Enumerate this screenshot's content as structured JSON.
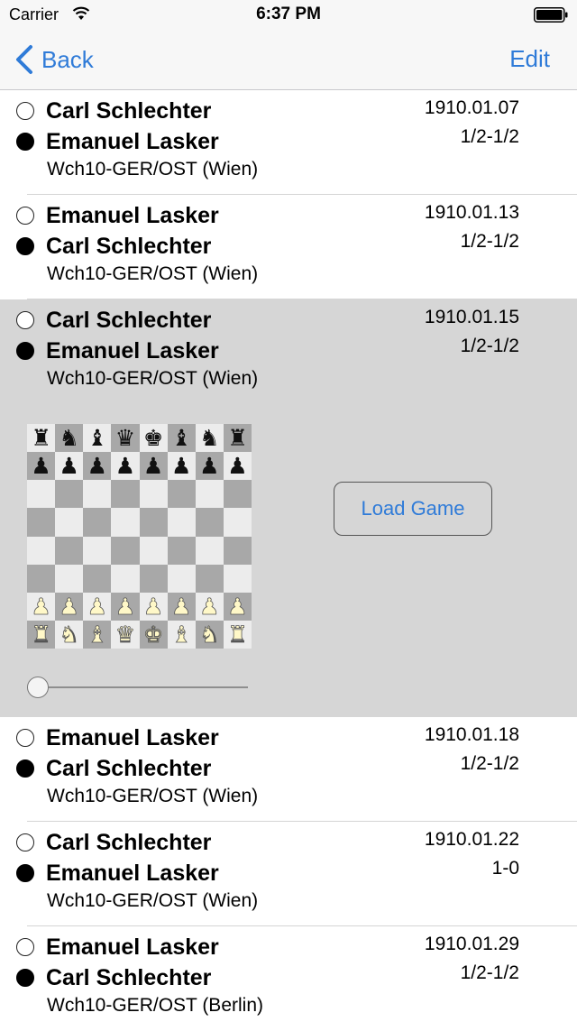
{
  "status_bar": {
    "carrier": "Carrier",
    "time": "6:37 PM",
    "wifi_icon": "wifi-icon",
    "battery_icon": "battery-icon"
  },
  "nav": {
    "back_label": "Back",
    "back_icon": "chevron-left-icon",
    "edit_label": "Edit"
  },
  "colors": {
    "accent": "#2f7bd8",
    "expanded_bg": "#d6d6d6"
  },
  "games": [
    {
      "white": "Carl Schlechter",
      "black": "Emanuel Lasker",
      "event": "Wch10-GER/OST (Wien)",
      "date": "1910.01.07",
      "result": "1/2-1/2"
    },
    {
      "white": "Emanuel Lasker",
      "black": "Carl Schlechter",
      "event": "Wch10-GER/OST (Wien)",
      "date": "1910.01.13",
      "result": "1/2-1/2"
    },
    {
      "white": "Carl Schlechter",
      "black": "Emanuel Lasker",
      "event": "Wch10-GER/OST (Wien)",
      "date": "1910.01.15",
      "result": "1/2-1/2",
      "expanded": true
    },
    {
      "white": "Emanuel Lasker",
      "black": "Carl Schlechter",
      "event": "Wch10-GER/OST (Wien)",
      "date": "1910.01.18",
      "result": "1/2-1/2"
    },
    {
      "white": "Carl Schlechter",
      "black": "Emanuel Lasker",
      "event": "Wch10-GER/OST (Wien)",
      "date": "1910.01.22",
      "result": "1-0"
    },
    {
      "white": "Emanuel Lasker",
      "black": "Carl Schlechter",
      "event": "Wch10-GER/OST (Berlin)",
      "date": "1910.01.29",
      "result": "1/2-1/2"
    }
  ],
  "preview": {
    "load_button_label": "Load Game",
    "slider_position": 0,
    "board": [
      [
        "r",
        "n",
        "b",
        "q",
        "k",
        "b",
        "n",
        "r"
      ],
      [
        "p",
        "p",
        "p",
        "p",
        "p",
        "p",
        "p",
        "p"
      ],
      [
        "",
        "",
        "",
        "",
        "",
        "",
        "",
        ""
      ],
      [
        "",
        "",
        "",
        "",
        "",
        "",
        "",
        ""
      ],
      [
        "",
        "",
        "",
        "",
        "",
        "",
        "",
        ""
      ],
      [
        "",
        "",
        "",
        "",
        "",
        "",
        "",
        ""
      ],
      [
        "P",
        "P",
        "P",
        "P",
        "P",
        "P",
        "P",
        "P"
      ],
      [
        "R",
        "N",
        "B",
        "Q",
        "K",
        "B",
        "N",
        "R"
      ]
    ]
  }
}
